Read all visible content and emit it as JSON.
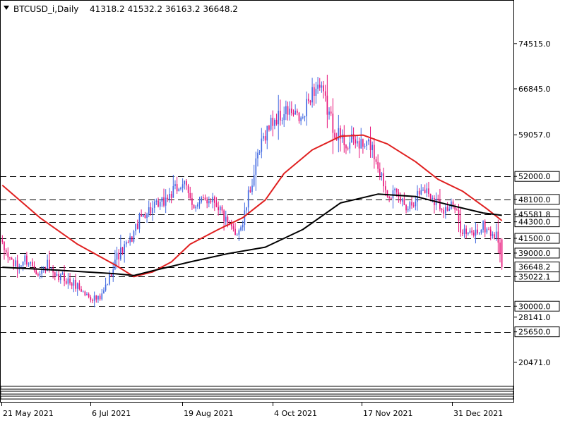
{
  "header": {
    "symbol_label": "BTCUSD_i,Daily",
    "ohlc_label": "41318.2 41532.2 36163.2 36648.2"
  },
  "colors": {
    "bull": "#4169e1",
    "bear": "#e8157a",
    "ma_fast": "#e02020",
    "ma_slow": "#000000",
    "level_line": "#000000",
    "background": "#ffffff"
  },
  "chart_data": {
    "type": "candlestick",
    "symbol": "BTCUSD_i",
    "timeframe": "Daily",
    "x_axis_labels": [
      "21 May 2021",
      "6 Jul 2021",
      "19 Aug 2021",
      "4 Oct 2021",
      "17 Nov 2021",
      "31 Dec 2021"
    ],
    "y_axis_labels": [
      74515.0,
      66845.0,
      59057.0,
      28141.0,
      20471.0
    ],
    "ylim": [
      16000,
      82500
    ],
    "horizontal_levels": [
      52000.0,
      48100.0,
      45581.8,
      44300.0,
      41500.0,
      39000.0,
      36648.2,
      35022.1,
      30000.0,
      25650.0
    ],
    "current_price": 36648.2,
    "ohlc_last": {
      "open": 41318.2,
      "high": 41532.2,
      "low": 36163.2,
      "close": 36648.2
    },
    "price_path": [
      [
        0,
        40000
      ],
      [
        4,
        38000
      ],
      [
        8,
        36500
      ],
      [
        12,
        38000
      ],
      [
        16,
        37000
      ],
      [
        20,
        35500
      ],
      [
        24,
        37000
      ],
      [
        28,
        34500
      ],
      [
        32,
        35000
      ],
      [
        36,
        34000
      ],
      [
        40,
        33500
      ],
      [
        44,
        32000
      ],
      [
        48,
        31500
      ],
      [
        52,
        31000
      ],
      [
        56,
        34000
      ],
      [
        60,
        38000
      ],
      [
        64,
        39500
      ],
      [
        68,
        41000
      ],
      [
        72,
        44000
      ],
      [
        76,
        46000
      ],
      [
        80,
        46500
      ],
      [
        84,
        47000
      ],
      [
        88,
        48500
      ],
      [
        92,
        49500
      ],
      [
        96,
        51000
      ],
      [
        100,
        48000
      ],
      [
        104,
        47000
      ],
      [
        108,
        48000
      ],
      [
        112,
        48500
      ],
      [
        116,
        46500
      ],
      [
        120,
        43500
      ],
      [
        124,
        42500
      ],
      [
        128,
        44000
      ],
      [
        132,
        50000
      ],
      [
        136,
        55000
      ],
      [
        140,
        59500
      ],
      [
        144,
        61500
      ],
      [
        148,
        62000
      ],
      [
        152,
        63000
      ],
      [
        156,
        62000
      ],
      [
        160,
        61500
      ],
      [
        164,
        66000
      ],
      [
        168,
        67500
      ],
      [
        172,
        64500
      ],
      [
        176,
        60500
      ],
      [
        180,
        58500
      ],
      [
        184,
        57500
      ],
      [
        188,
        58000
      ],
      [
        192,
        57000
      ],
      [
        196,
        57500
      ],
      [
        200,
        54000
      ],
      [
        204,
        50000
      ],
      [
        208,
        49000
      ],
      [
        212,
        48000
      ],
      [
        216,
        47000
      ],
      [
        220,
        48500
      ],
      [
        224,
        50000
      ],
      [
        228,
        49000
      ],
      [
        232,
        47500
      ],
      [
        236,
        46500
      ],
      [
        240,
        47000
      ],
      [
        244,
        43500
      ],
      [
        248,
        42000
      ],
      [
        252,
        42500
      ],
      [
        256,
        43500
      ],
      [
        260,
        42500
      ],
      [
        264,
        41500
      ],
      [
        266,
        36648.2
      ]
    ],
    "series": [
      {
        "name": "MA fast",
        "points": [
          [
            0,
            50500
          ],
          [
            20,
            45000
          ],
          [
            40,
            40500
          ],
          [
            60,
            37000
          ],
          [
            70,
            35000
          ],
          [
            80,
            35800
          ],
          [
            90,
            37500
          ],
          [
            100,
            40500
          ],
          [
            115,
            43000
          ],
          [
            128,
            45000
          ],
          [
            140,
            48000
          ],
          [
            150,
            52500
          ],
          [
            165,
            56500
          ],
          [
            180,
            58800
          ],
          [
            192,
            59000
          ],
          [
            205,
            57500
          ],
          [
            220,
            54500
          ],
          [
            232,
            51500
          ],
          [
            245,
            49500
          ],
          [
            258,
            46500
          ],
          [
            266,
            44500
          ]
        ]
      },
      {
        "name": "MA slow",
        "points": [
          [
            0,
            36600
          ],
          [
            30,
            36100
          ],
          [
            60,
            35500
          ],
          [
            70,
            35200
          ],
          [
            80,
            36000
          ],
          [
            100,
            37500
          ],
          [
            120,
            38900
          ],
          [
            140,
            40000
          ],
          [
            160,
            43000
          ],
          [
            180,
            47500
          ],
          [
            200,
            49000
          ],
          [
            220,
            48600
          ],
          [
            240,
            47000
          ],
          [
            256,
            45800
          ],
          [
            266,
            45400
          ]
        ]
      }
    ]
  }
}
